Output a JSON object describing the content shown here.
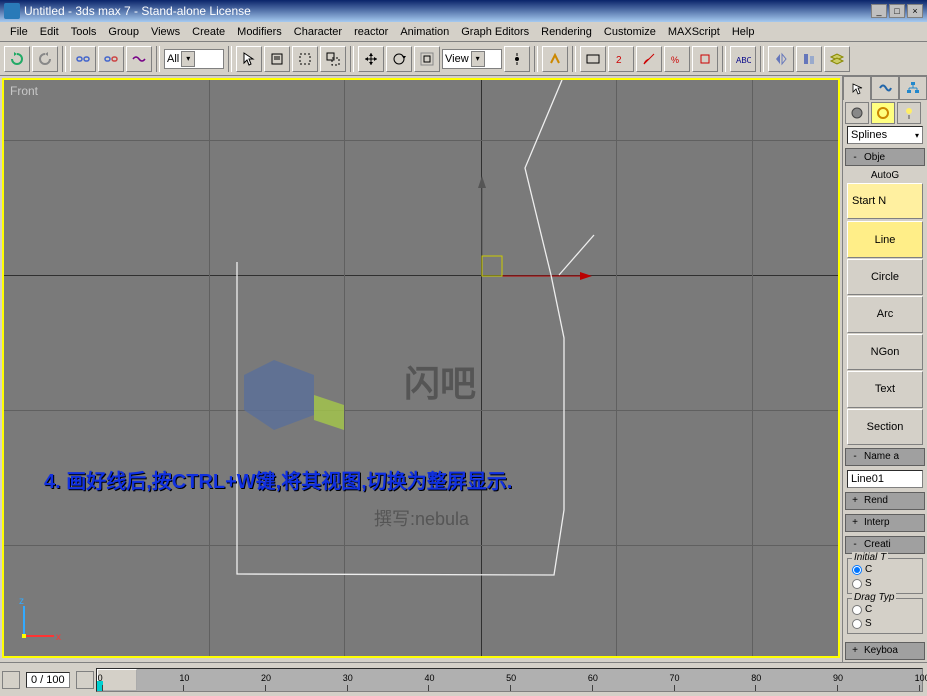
{
  "window": {
    "title": "Untitled  - 3ds max 7  - Stand-alone License"
  },
  "menu": [
    "File",
    "Edit",
    "Tools",
    "Group",
    "Views",
    "Create",
    "Modifiers",
    "Character",
    "reactor",
    "Animation",
    "Graph Editors",
    "Rendering",
    "Customize",
    "MAXScript",
    "Help"
  ],
  "toolbar": {
    "selset_combo": "All",
    "view_combo": "View"
  },
  "viewport": {
    "label": "Front",
    "axis_z": "z",
    "axis_x": "x",
    "annotation": "4. 画好线后,按CTRL+W键,将其视图,切换为整屏显示.",
    "watermark_main": "闪吧",
    "watermark_author": "撰写:nebula"
  },
  "panel": {
    "subtype_combo": "Splines",
    "rollout_objtype": "Obje",
    "autogrid": "AutoG",
    "startnew": "Start N",
    "buttons": [
      "Line",
      "Circle",
      "Arc",
      "NGon",
      "Text",
      "Section"
    ],
    "rollout_name": "Name a",
    "name_value": "Line01",
    "rollout_render": "Rend",
    "rollout_interp": "Interp",
    "rollout_create": "Creati",
    "initial_legend": "Initial T",
    "drag_legend": "Drag Typ",
    "radio_c": "C",
    "radio_s": "S",
    "rollout_keyboard": "Keyboa"
  },
  "bottom": {
    "frame": "0  /  100",
    "ticks": [
      "0",
      "10",
      "20",
      "30",
      "40",
      "50",
      "60",
      "70",
      "80",
      "90",
      "100"
    ]
  }
}
